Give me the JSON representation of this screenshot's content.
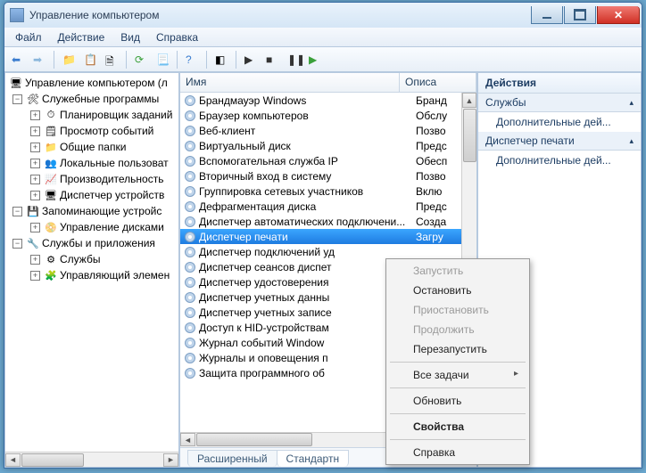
{
  "window": {
    "title": "Управление компьютером"
  },
  "menubar": [
    "Файл",
    "Действие",
    "Вид",
    "Справка"
  ],
  "tree": {
    "root": "Управление компьютером (л",
    "groups": [
      {
        "label": "Служебные программы",
        "icon": "🛠",
        "expanded": true,
        "children": [
          {
            "label": "Планировщик заданий",
            "icon": "⏱"
          },
          {
            "label": "Просмотр событий",
            "icon": "🗒"
          },
          {
            "label": "Общие папки",
            "icon": "📁"
          },
          {
            "label": "Локальные пользоват",
            "icon": "👥"
          },
          {
            "label": "Производительность",
            "icon": "📈"
          },
          {
            "label": "Диспетчер устройств",
            "icon": "🖥"
          }
        ]
      },
      {
        "label": "Запоминающие устройс",
        "icon": "💾",
        "expanded": true,
        "children": [
          {
            "label": "Управление дисками",
            "icon": "📀"
          }
        ]
      },
      {
        "label": "Службы и приложения",
        "icon": "🔧",
        "expanded": true,
        "children": [
          {
            "label": "Службы",
            "icon": "⚙"
          },
          {
            "label": "Управляющий элемен",
            "icon": "🧩"
          }
        ]
      }
    ]
  },
  "list": {
    "columns": {
      "name": "Имя",
      "desc": "Описа"
    },
    "rows": [
      {
        "name": "Брандмауэр Windows",
        "desc": "Бранд"
      },
      {
        "name": "Браузер компьютеров",
        "desc": "Обслу"
      },
      {
        "name": "Веб-клиент",
        "desc": "Позво"
      },
      {
        "name": "Виртуальный диск",
        "desc": "Предс"
      },
      {
        "name": "Вспомогательная служба IP",
        "desc": "Обесп"
      },
      {
        "name": "Вторичный вход в систему",
        "desc": "Позво"
      },
      {
        "name": "Группировка сетевых участников",
        "desc": "Вклю"
      },
      {
        "name": "Дефрагментация диска",
        "desc": "Предс"
      },
      {
        "name": "Диспетчер автоматических подключени...",
        "desc": "Созда"
      },
      {
        "name": "Диспетчер печати",
        "desc": "Загру",
        "selected": true
      },
      {
        "name": "Диспетчер подключений уд",
        "desc": ""
      },
      {
        "name": "Диспетчер сеансов диспет",
        "desc": ""
      },
      {
        "name": "Диспетчер удостоверения",
        "desc": ""
      },
      {
        "name": "Диспетчер учетных данны",
        "desc": ""
      },
      {
        "name": "Диспетчер учетных записе",
        "desc": ""
      },
      {
        "name": "Доступ к HID-устройствам",
        "desc": ""
      },
      {
        "name": "Журнал событий Window",
        "desc": ""
      },
      {
        "name": "Журналы и оповещения п",
        "desc": ""
      },
      {
        "name": "Защита программного об",
        "desc": ""
      }
    ],
    "tabs": {
      "extended": "Расширенный",
      "standard": "Стандартн"
    }
  },
  "actions": {
    "header": "Действия",
    "groups": [
      {
        "title": "Службы",
        "items": [
          "Дополнительные дей..."
        ]
      },
      {
        "title": "Диспетчер печати",
        "items": [
          "Дополнительные дей..."
        ]
      }
    ]
  },
  "context": {
    "items": [
      {
        "label": "Запустить",
        "disabled": true
      },
      {
        "label": "Остановить"
      },
      {
        "label": "Приостановить",
        "disabled": true
      },
      {
        "label": "Продолжить",
        "disabled": true
      },
      {
        "label": "Перезапустить"
      },
      {
        "sep": true
      },
      {
        "label": "Все задачи",
        "sub": true
      },
      {
        "sep": true
      },
      {
        "label": "Обновить"
      },
      {
        "sep": true
      },
      {
        "label": "Свойства",
        "bold": true
      },
      {
        "sep": true
      },
      {
        "label": "Справка"
      }
    ]
  }
}
